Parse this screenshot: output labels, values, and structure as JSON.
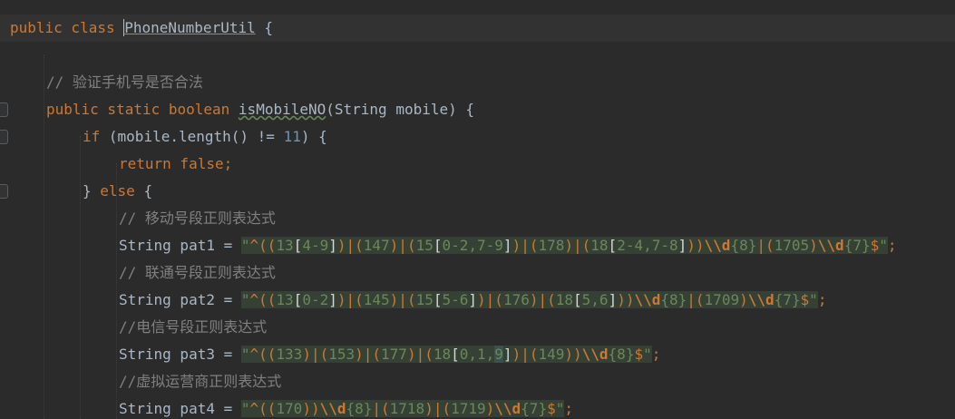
{
  "editor": {
    "lines": [
      {
        "tokens": [
          {
            "t": "public class ",
            "c": "kw"
          },
          {
            "t": "PhoneNumberUtil",
            "c": "cls-name"
          },
          {
            "t": " {",
            "c": "plain"
          }
        ]
      },
      {
        "tokens": []
      },
      {
        "tokens": [
          {
            "t": "// 验证手机号是否合法",
            "c": "cm"
          }
        ]
      },
      {
        "tokens": [
          {
            "t": "public static boolean ",
            "c": "kw"
          },
          {
            "t": "isMobileNO",
            "c": "ref"
          },
          {
            "t": "(String mobile) {",
            "c": "plain"
          }
        ]
      },
      {
        "tokens": [
          {
            "t": "if ",
            "c": "kw"
          },
          {
            "t": "(mobile.length() != ",
            "c": "plain"
          },
          {
            "t": "11",
            "c": "num"
          },
          {
            "t": ") {",
            "c": "plain"
          }
        ]
      },
      {
        "tokens": [
          {
            "t": "return false;",
            "c": "kw"
          }
        ]
      },
      {
        "tokens": [
          {
            "t": "} ",
            "c": "plain"
          },
          {
            "t": "else ",
            "c": "kw"
          },
          {
            "t": "{",
            "c": "plain"
          }
        ]
      },
      {
        "tokens": [
          {
            "t": "// 移动号段正则表达式",
            "c": "cm"
          }
        ]
      },
      {
        "tokens": [
          {
            "t": "String pat1 = ",
            "c": "plain"
          },
          {
            "t": "\"",
            "c": "str"
          },
          {
            "t": "^",
            "c": "str re-grp"
          },
          {
            "t": "((",
            "c": "str re-grp"
          },
          {
            "t": "13",
            "c": "str"
          },
          {
            "t": "[",
            "c": "str re-br"
          },
          {
            "t": "4-9",
            "c": "str"
          },
          {
            "t": "]",
            "c": "str re-br"
          },
          {
            "t": ")|(",
            "c": "str re-grp"
          },
          {
            "t": "147",
            "c": "str"
          },
          {
            "t": ")|(",
            "c": "str re-grp"
          },
          {
            "t": "15",
            "c": "str"
          },
          {
            "t": "[",
            "c": "str re-br"
          },
          {
            "t": "0-2,7-9",
            "c": "str"
          },
          {
            "t": "]",
            "c": "str re-br"
          },
          {
            "t": ")|(",
            "c": "str re-grp"
          },
          {
            "t": "178",
            "c": "str"
          },
          {
            "t": ")|(",
            "c": "str re-grp"
          },
          {
            "t": "18",
            "c": "str"
          },
          {
            "t": "[",
            "c": "str re-br"
          },
          {
            "t": "2-4,7-8",
            "c": "str"
          },
          {
            "t": "]",
            "c": "str re-br"
          },
          {
            "t": "))",
            "c": "str re-grp"
          },
          {
            "t": "\\\\d",
            "c": "str re-esc"
          },
          {
            "t": "{8}",
            "c": "str num"
          },
          {
            "t": "|(",
            "c": "str re-grp"
          },
          {
            "t": "1705",
            "c": "str"
          },
          {
            "t": ")",
            "c": "str re-grp"
          },
          {
            "t": "\\\\d",
            "c": "str re-esc"
          },
          {
            "t": "{7}",
            "c": "str num"
          },
          {
            "t": "$",
            "c": "str re-grp"
          },
          {
            "t": "\"",
            "c": "str"
          },
          {
            "t": ";",
            "c": "kw"
          }
        ]
      },
      {
        "tokens": [
          {
            "t": "// 联通号段正则表达式",
            "c": "cm"
          }
        ]
      },
      {
        "tokens": [
          {
            "t": "String pat2 = ",
            "c": "plain"
          },
          {
            "t": "\"",
            "c": "str"
          },
          {
            "t": "^",
            "c": "str re-grp"
          },
          {
            "t": "((",
            "c": "str re-grp"
          },
          {
            "t": "13",
            "c": "str"
          },
          {
            "t": "[",
            "c": "str re-br"
          },
          {
            "t": "0-2",
            "c": "str"
          },
          {
            "t": "]",
            "c": "str re-br"
          },
          {
            "t": ")|(",
            "c": "str re-grp"
          },
          {
            "t": "145",
            "c": "str"
          },
          {
            "t": ")|(",
            "c": "str re-grp"
          },
          {
            "t": "15",
            "c": "str"
          },
          {
            "t": "[",
            "c": "str re-br"
          },
          {
            "t": "5-6",
            "c": "str"
          },
          {
            "t": "]",
            "c": "str re-br"
          },
          {
            "t": ")|(",
            "c": "str re-grp"
          },
          {
            "t": "176",
            "c": "str"
          },
          {
            "t": ")|(",
            "c": "str re-grp"
          },
          {
            "t": "18",
            "c": "str"
          },
          {
            "t": "[",
            "c": "str re-br"
          },
          {
            "t": "5,6",
            "c": "str"
          },
          {
            "t": "]",
            "c": "str re-br"
          },
          {
            "t": "))",
            "c": "str re-grp"
          },
          {
            "t": "\\\\d",
            "c": "str re-esc"
          },
          {
            "t": "{8}",
            "c": "str num"
          },
          {
            "t": "|(",
            "c": "str re-grp"
          },
          {
            "t": "1709",
            "c": "str"
          },
          {
            "t": ")",
            "c": "str re-grp"
          },
          {
            "t": "\\\\d",
            "c": "str re-esc"
          },
          {
            "t": "{7}",
            "c": "str num"
          },
          {
            "t": "$",
            "c": "str re-grp"
          },
          {
            "t": "\"",
            "c": "str"
          },
          {
            "t": ";",
            "c": "kw"
          }
        ]
      },
      {
        "tokens": [
          {
            "t": "//电信号段正则表达式",
            "c": "cm"
          }
        ]
      },
      {
        "tokens": [
          {
            "t": "String pat3 = ",
            "c": "plain"
          },
          {
            "t": "\"",
            "c": "str"
          },
          {
            "t": "^",
            "c": "str re-grp"
          },
          {
            "t": "((",
            "c": "str re-grp"
          },
          {
            "t": "133",
            "c": "str"
          },
          {
            "t": ")|(",
            "c": "str re-grp"
          },
          {
            "t": "153",
            "c": "str"
          },
          {
            "t": ")|(",
            "c": "str re-grp"
          },
          {
            "t": "177",
            "c": "str"
          },
          {
            "t": ")|(",
            "c": "str re-grp"
          },
          {
            "t": "18",
            "c": "str"
          },
          {
            "t": "[",
            "c": "str re-br"
          },
          {
            "t": "0,1,",
            "c": "str"
          },
          {
            "t": "9",
            "c": "str caret-bg"
          },
          {
            "t": "]",
            "c": "str re-br"
          },
          {
            "t": ")|(",
            "c": "str re-grp"
          },
          {
            "t": "149",
            "c": "str"
          },
          {
            "t": "))",
            "c": "str re-grp"
          },
          {
            "t": "\\\\d",
            "c": "str re-esc"
          },
          {
            "t": "{8}",
            "c": "str num"
          },
          {
            "t": "$",
            "c": "str re-grp"
          },
          {
            "t": "\"",
            "c": "str"
          },
          {
            "t": ";",
            "c": "kw"
          }
        ]
      },
      {
        "tokens": [
          {
            "t": "//虚拟运营商正则表达式",
            "c": "cm"
          }
        ]
      },
      {
        "tokens": [
          {
            "t": "String pat4 = ",
            "c": "plain"
          },
          {
            "t": "\"",
            "c": "str"
          },
          {
            "t": "^",
            "c": "str re-grp"
          },
          {
            "t": "((",
            "c": "str re-grp"
          },
          {
            "t": "170",
            "c": "str"
          },
          {
            "t": "))",
            "c": "str re-grp"
          },
          {
            "t": "\\\\d",
            "c": "str re-esc"
          },
          {
            "t": "{8}",
            "c": "str num"
          },
          {
            "t": "|(",
            "c": "str re-grp"
          },
          {
            "t": "1718",
            "c": "str"
          },
          {
            "t": ")|(",
            "c": "str re-grp"
          },
          {
            "t": "1719",
            "c": "str"
          },
          {
            "t": ")",
            "c": "str re-grp"
          },
          {
            "t": "\\\\d",
            "c": "str re-esc"
          },
          {
            "t": "{7}",
            "c": "str num"
          },
          {
            "t": "$",
            "c": "str re-grp"
          },
          {
            "t": "\"",
            "c": "str"
          },
          {
            "t": ";",
            "c": "kw"
          }
        ]
      }
    ]
  },
  "colors": {
    "background": "#2b2b2b",
    "keyword": "#cc7832",
    "comment": "#808080",
    "string": "#6a8759",
    "string_bg": "#364135",
    "number": "#6897bb",
    "text": "#a9b7c6"
  }
}
